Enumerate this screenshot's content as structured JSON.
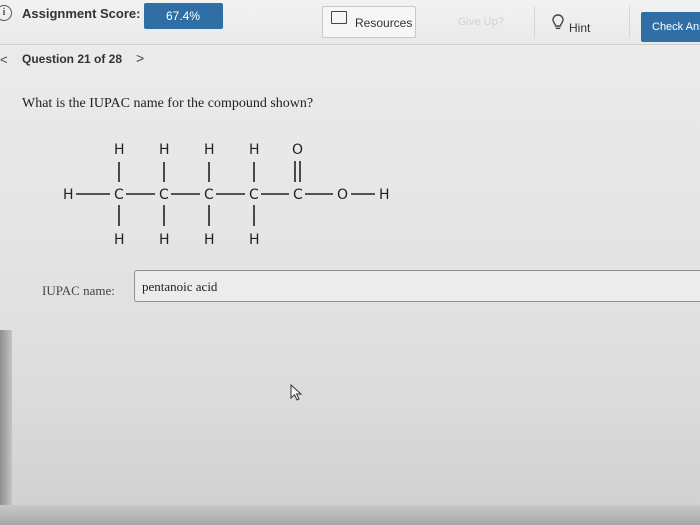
{
  "header": {
    "score_label": "Assignment Score:",
    "score_value": "67.4%",
    "resources_label": "Resources",
    "faded_label": "Give Up?",
    "hint_label": "Hint",
    "check_answer_label": "Check Ans",
    "icons": [
      "info-icon",
      "book-icon",
      "lightbulb-icon"
    ],
    "accent_color": "#2f6fa6"
  },
  "question": {
    "counter": "Question 21 of 28",
    "next_symbol": ">",
    "prev_symbol": "<",
    "text": "What is the IUPAC name for the compound shown?"
  },
  "structure": {
    "top_atoms": [
      "H",
      "H",
      "H",
      "H",
      "O"
    ],
    "chain": [
      "H",
      "C",
      "C",
      "C",
      "C",
      "C",
      "O",
      "H"
    ],
    "bottom_atoms": [
      "H",
      "H",
      "H",
      "H"
    ]
  },
  "answer": {
    "label": "IUPAC name:",
    "value": "pentanoic acid"
  }
}
